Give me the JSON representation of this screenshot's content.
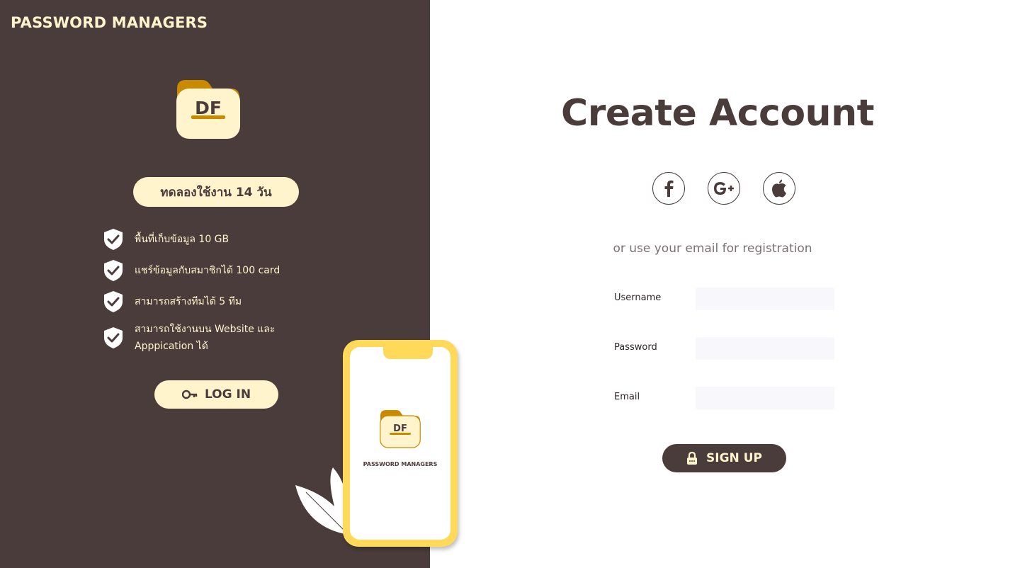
{
  "brand": {
    "title": "PASSWORD MANAGERS",
    "logo_text": "DF"
  },
  "trial": {
    "label": "ทดลองใช้งาน 14 วัน"
  },
  "features": [
    "พื้นที่เก็บข้อมูล 10 GB",
    "แชร์ข้อมูลกับสมาชิกได้ 100 card",
    "สามารถสร้างทีมได้ 5 ทีม",
    "สามารถใช้งานบน Website และ Apppication ได้"
  ],
  "login": {
    "label": "LOG IN",
    "icon": "key-icon"
  },
  "phone": {
    "logo_text": "DF",
    "brand": "PASSWORD MANAGERS"
  },
  "form": {
    "title": "Create Account",
    "social": [
      "facebook-icon",
      "google-plus-icon",
      "apple-icon"
    ],
    "or_text": "or use your email for registration",
    "fields": [
      {
        "label": "Username",
        "value": ""
      },
      {
        "label": "Password",
        "value": ""
      },
      {
        "label": "Email",
        "value": ""
      }
    ],
    "signup_label": "SIGN UP",
    "signup_icon": "lock-icon"
  },
  "colors": {
    "panel": "#4a3c3b",
    "cream": "#fff4cc",
    "gold": "#c98a00",
    "phone_yellow": "#ffd95a",
    "input_bg": "#f7f7fc"
  }
}
